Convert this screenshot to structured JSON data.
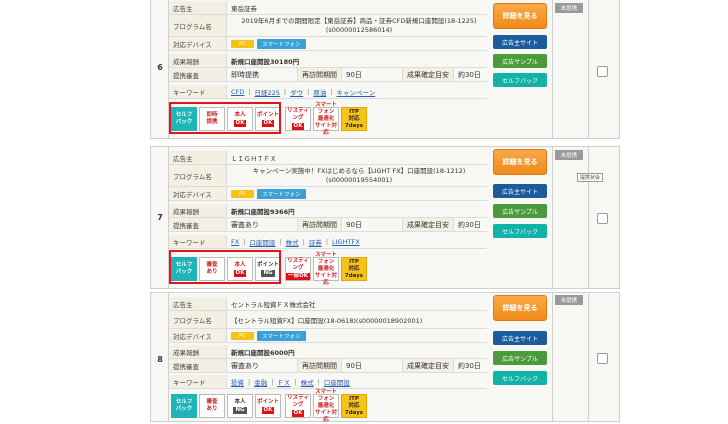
{
  "labels": {
    "advertiser": "広告主",
    "program": "プログラム名",
    "device": "対応デバイス",
    "reward": "成果報酬",
    "approval": "提携審査",
    "revisit": "再訪問期間",
    "confirm": "成果確定目安",
    "keyword": "キーワード",
    "pc": "PC",
    "sp": "スマートフォン",
    "days90": "90日",
    "days30": "約30日",
    "detail_btn": "詳細を見る",
    "advertiser_btn": "広告主サイト",
    "sample_btn": "広告サンプル",
    "selfback_btn": "セルフバック",
    "status": "未提携",
    "tooltip": "提携状会"
  },
  "badges": {
    "self_l1": "セルフ",
    "self_l2": "バック",
    "instant_l1": "即時",
    "instant_l2": "提携",
    "review_l1": "審査",
    "review_l2": "あり",
    "person": "本人",
    "ok": "OK",
    "ng": "NG",
    "point": "ポイント",
    "listing_l1": "リスティ",
    "listing_l2": "ング",
    "listing_part": "一部OK",
    "smart_l1": "スマート",
    "smart_l2": "フォン",
    "smart_l3": "最適化",
    "smart_l4": "サイト対応",
    "itp_l1": "ITP",
    "itp_l2": "対応",
    "itp_l3": "7days"
  },
  "rows": [
    {
      "number": "6",
      "advertiser": "東岳証券",
      "program_l1": "2019年6月までの期間限定【東岳証券】商品・証券CFD新規口座開設(18-1225)",
      "program_l2": "(s00000012586014)",
      "reward": "新規口座開設30180円",
      "approval": "即時提携",
      "keywords": [
        "CFD",
        "日経225",
        "ダウ",
        "原油",
        "キャンペーン"
      ]
    },
    {
      "number": "7",
      "advertiser": "ＬＩＧＨＴＦＸ",
      "program_l1": "キャンペーン実施中！FXはじめるなら【LIGHT FX】口座開設(18-1212)",
      "program_l2": "(s00000019554001)",
      "reward": "新規口座開設9366円",
      "approval": "審査あり",
      "keywords": [
        "FX",
        "口座開設",
        "株式",
        "証券",
        "LIGHTFX"
      ]
    },
    {
      "number": "8",
      "advertiser": "セントラル短資ＦＸ株式会社",
      "program_l1": "【セントラル短資FX】口座開設(18-0618)(s00000018902001)",
      "program_l2": "",
      "reward": "新規口座開設6000円",
      "approval": "審査あり",
      "keywords": [
        "投資",
        "金融",
        "ＦＸ",
        "株式",
        "口座開設"
      ]
    }
  ]
}
